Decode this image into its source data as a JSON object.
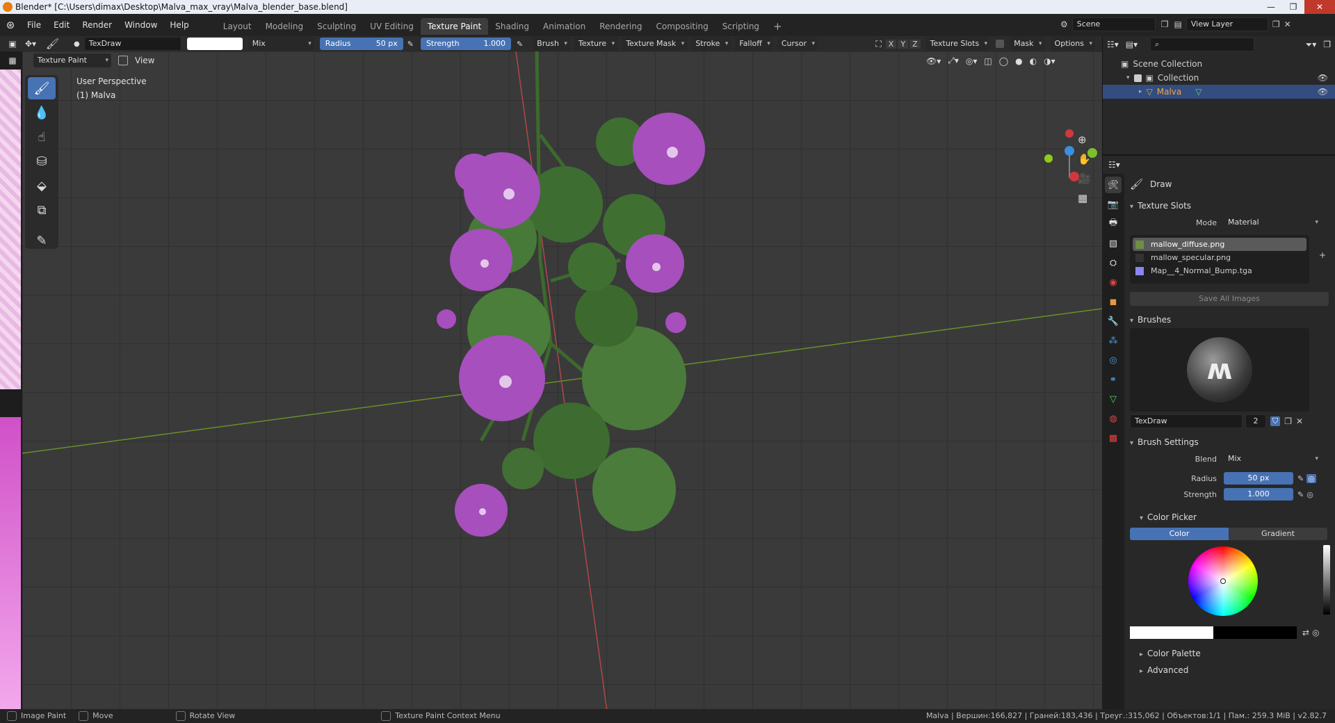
{
  "window": {
    "title": "Blender* [C:\\Users\\dimax\\Desktop\\Malva_max_vray\\Malva_blender_base.blend]"
  },
  "menu": [
    "File",
    "Edit",
    "Render",
    "Window",
    "Help"
  ],
  "workspaces": [
    {
      "label": "Layout",
      "active": false
    },
    {
      "label": "Modeling",
      "active": false
    },
    {
      "label": "Sculpting",
      "active": false
    },
    {
      "label": "UV Editing",
      "active": false
    },
    {
      "label": "Texture Paint",
      "active": true
    },
    {
      "label": "Shading",
      "active": false
    },
    {
      "label": "Animation",
      "active": false
    },
    {
      "label": "Rendering",
      "active": false
    },
    {
      "label": "Compositing",
      "active": false
    },
    {
      "label": "Scripting",
      "active": false
    }
  ],
  "scene": {
    "name": "Scene",
    "view_layer": "View Layer"
  },
  "header": {
    "brush_name": "TexDraw",
    "blend": "Mix",
    "radius_label": "Radius",
    "radius_value": "50 px",
    "strength_label": "Strength",
    "strength_value": "1.000",
    "menus": [
      "Brush",
      "Texture",
      "Texture Mask",
      "Stroke",
      "Falloff",
      "Cursor"
    ],
    "axes": [
      "X",
      "Y",
      "Z"
    ],
    "texture_slots": "Texture Slots",
    "mask": "Mask",
    "options": "Options"
  },
  "header2": {
    "mode": "Texture Paint",
    "view": "View"
  },
  "viewport": {
    "perspective": "User Perspective",
    "object": "(1) Malva"
  },
  "outliner": {
    "items": [
      "Scene Collection",
      "Collection",
      "Malva"
    ]
  },
  "properties": {
    "tool_name": "Draw",
    "texture_slots": {
      "title": "Texture Slots",
      "mode_label": "Mode",
      "mode_value": "Material",
      "slots": [
        "mallow_diffuse.png",
        "mallow_specular.png",
        "Map__4_Normal_Bump.tga"
      ],
      "save_all": "Save All Images"
    },
    "brushes": {
      "title": "Brushes",
      "brush_name": "TexDraw",
      "users": "2"
    },
    "brush_settings": {
      "title": "Brush Settings",
      "blend_label": "Blend",
      "blend_value": "Mix",
      "radius_label": "Radius",
      "radius_value": "50 px",
      "strength_label": "Strength",
      "strength_value": "1.000"
    },
    "color_picker": {
      "title": "Color Picker",
      "tab_color": "Color",
      "tab_gradient": "Gradient"
    },
    "color_palette": "Color Palette",
    "advanced": "Advanced"
  },
  "status": {
    "image_paint": "Image Paint",
    "move": "Move",
    "rotate": "Rotate View",
    "context": "Texture Paint Context Menu",
    "stats": "Malva | Вершин:166,827 | Граней:183,436 | Треуг.:315,062 | Объектов:1/1 | Пам.: 259.3 MiB | v2.82.7"
  },
  "colors": {
    "accent": "#4772b3",
    "selected": "#334d80",
    "bg": "#3a3a3a"
  }
}
